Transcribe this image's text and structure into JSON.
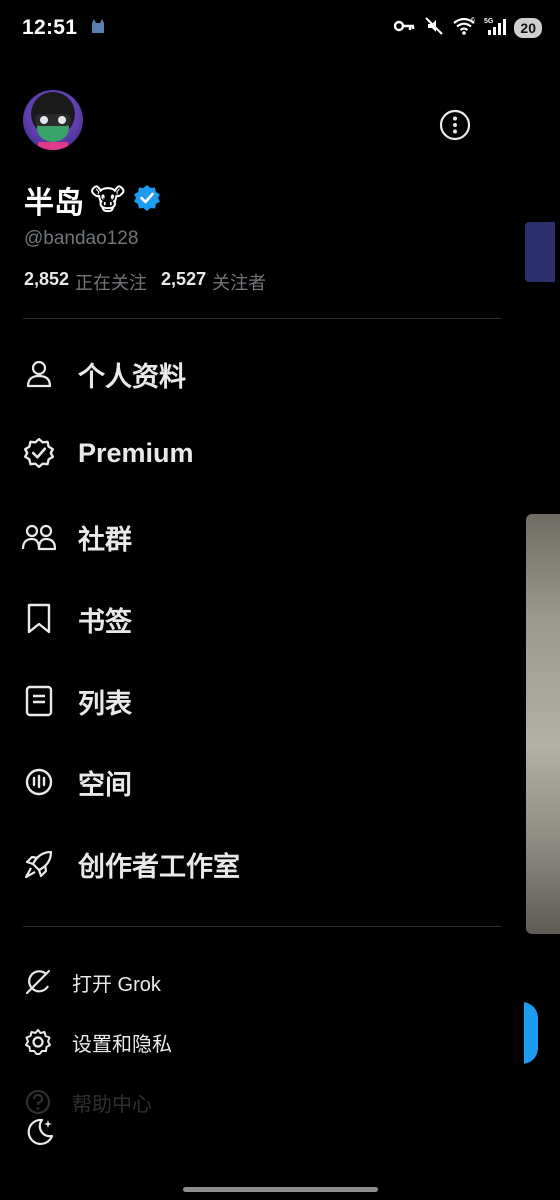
{
  "status_bar": {
    "time": "12:51",
    "battery": "20",
    "network": "5G",
    "sim": "6"
  },
  "profile": {
    "display_name": "半岛",
    "emoji": "🐮",
    "handle": "@bandao128",
    "following_count": "2,852",
    "following_label": "正在关注",
    "followers_count": "2,527",
    "followers_label": "关注者"
  },
  "menu": {
    "items": [
      {
        "label": "个人资料",
        "icon": "person-icon"
      },
      {
        "label": "Premium",
        "icon": "verified-badge-icon"
      },
      {
        "label": "社群",
        "icon": "people-icon"
      },
      {
        "label": "书签",
        "icon": "bookmark-icon"
      },
      {
        "label": "列表",
        "icon": "list-icon"
      },
      {
        "label": "空间",
        "icon": "spaces-icon"
      },
      {
        "label": "创作者工作室",
        "icon": "rocket-icon"
      }
    ],
    "secondary": [
      {
        "label": "打开 Grok",
        "icon": "grok-icon"
      },
      {
        "label": "设置和隐私",
        "icon": "gear-icon"
      },
      {
        "label": "帮助中心",
        "icon": "help-icon"
      }
    ]
  },
  "colors": {
    "background": "#000000",
    "text": "#e7e9ea",
    "muted": "#71767b",
    "accent": "#1d9bf0",
    "divider": "#2f3336"
  }
}
